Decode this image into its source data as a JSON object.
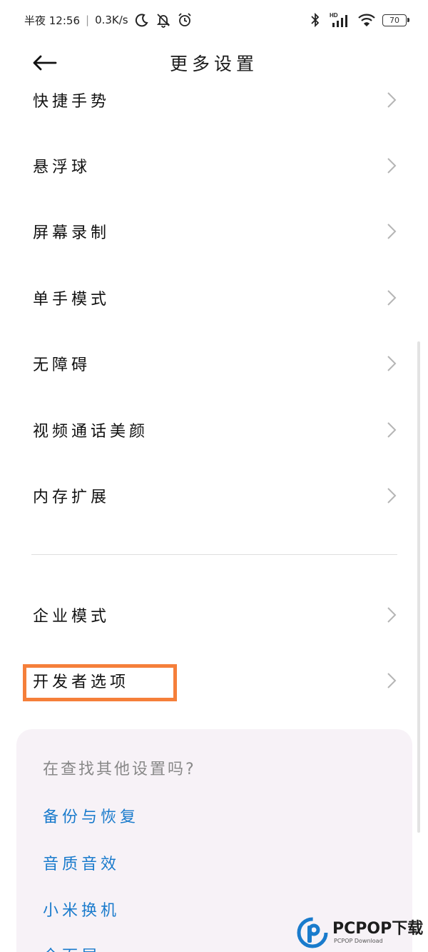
{
  "status_bar": {
    "time": "半夜 12:56",
    "speed": "0.3K/s",
    "battery": "70",
    "hd_label": "HD"
  },
  "header": {
    "title": "更多设置"
  },
  "list": {
    "items": [
      {
        "label": "快捷手势"
      },
      {
        "label": "悬浮球"
      },
      {
        "label": "屏幕录制"
      },
      {
        "label": "单手模式"
      },
      {
        "label": "无障碍"
      },
      {
        "label": "视频通话美颜"
      },
      {
        "label": "内存扩展"
      }
    ],
    "items_b": [
      {
        "label": "企业模式"
      },
      {
        "label": "开发者选项"
      }
    ]
  },
  "suggestions": {
    "title": "在查找其他设置吗?",
    "links": [
      "备份与恢复",
      "音质音效",
      "小米换机",
      "全面屏"
    ]
  },
  "watermark": {
    "main": "PCPOP下载",
    "sub": "PCPOP Download"
  },
  "colors": {
    "highlight": "#f57f3a",
    "link": "#1a7bcc",
    "card_bg": "#f7f2f7"
  }
}
